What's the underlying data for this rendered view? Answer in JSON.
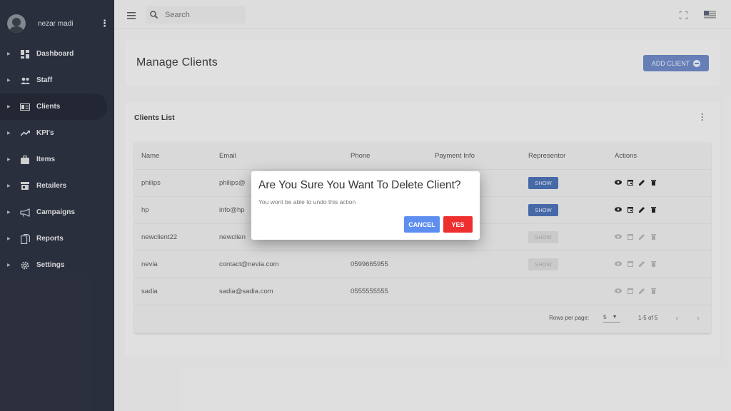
{
  "user": {
    "name": "nezar madi"
  },
  "sidebar": {
    "items": [
      {
        "label": "Dashboard",
        "icon": "dashboard-icon"
      },
      {
        "label": "Staff",
        "icon": "people-icon"
      },
      {
        "label": "Clients",
        "icon": "id-card-icon"
      },
      {
        "label": "KPI's",
        "icon": "trending-up-icon"
      },
      {
        "label": "Items",
        "icon": "briefcase-icon"
      },
      {
        "label": "Retailers",
        "icon": "store-icon"
      },
      {
        "label": "Campaigns",
        "icon": "megaphone-icon"
      },
      {
        "label": "Reports",
        "icon": "reports-icon"
      },
      {
        "label": "Settings",
        "icon": "gear-icon"
      }
    ],
    "active": "Clients"
  },
  "topbar": {
    "search_placeholder": "Search"
  },
  "page": {
    "title": "Manage Clients",
    "add_button": "ADD CLIENT"
  },
  "list": {
    "title": "Clients List",
    "columns": [
      "Name",
      "Email",
      "Phone",
      "Payment Info",
      "Representor",
      "Actions"
    ],
    "rows": [
      {
        "name": "philips",
        "email": "philips@",
        "phone": "",
        "payment": "",
        "rep": "SHOW"
      },
      {
        "name": "hp",
        "email": "info@hp",
        "phone": "",
        "payment": "",
        "rep": "SHOW"
      },
      {
        "name": "newclient22",
        "email": "newclien",
        "phone": "",
        "payment": "",
        "rep": "SHOW"
      },
      {
        "name": "nevia",
        "email": "contact@nevia.com",
        "phone": "0599665955",
        "payment": "",
        "rep": "SHOW"
      },
      {
        "name": "sadia",
        "email": "sadia@sadia.com",
        "phone": "0555555555",
        "payment": "",
        "rep": ""
      }
    ],
    "footer": {
      "rows_per_page_label": "Rows per page:",
      "rows_per_page": "5",
      "range": "1-5 of 5"
    }
  },
  "dialog": {
    "title": "Are You Sure You Want To Delete Client?",
    "text": "You wont be able to undo this action",
    "cancel": "CANCEL",
    "confirm": "YES"
  },
  "colors": {
    "sidebar_bg": "#2b3040",
    "primary": "#4a6fb4",
    "cancel": "#5e8ff0",
    "danger": "#ee2f2f"
  }
}
